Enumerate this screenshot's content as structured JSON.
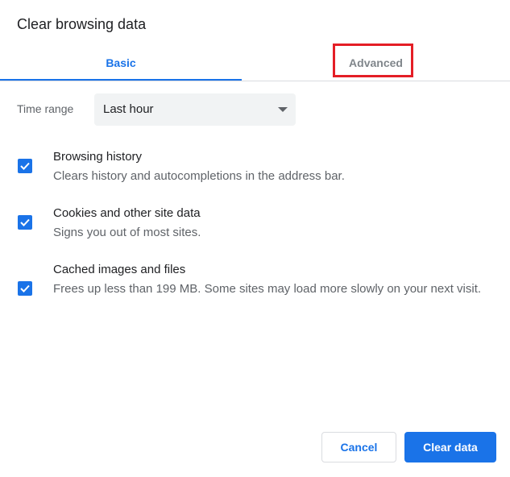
{
  "dialog": {
    "title": "Clear browsing data",
    "tabs": [
      {
        "label": "Basic",
        "selected": true
      },
      {
        "label": "Advanced",
        "selected": false
      }
    ],
    "time_range": {
      "label": "Time range",
      "selected": "Last hour"
    },
    "options": [
      {
        "label": "Browsing history",
        "description": "Clears history and autocompletions in the address bar.",
        "checked": true
      },
      {
        "label": "Cookies and other site data",
        "description": "Signs you out of most sites.",
        "checked": true
      },
      {
        "label": "Cached images and files",
        "description": "Frees up less than 199 MB. Some sites may load more slowly on your next visit.",
        "checked": true
      }
    ],
    "buttons": {
      "cancel": "Cancel",
      "clear": "Clear data"
    },
    "colors": {
      "accent": "#1a73e8",
      "highlight": "#e41e26"
    }
  }
}
